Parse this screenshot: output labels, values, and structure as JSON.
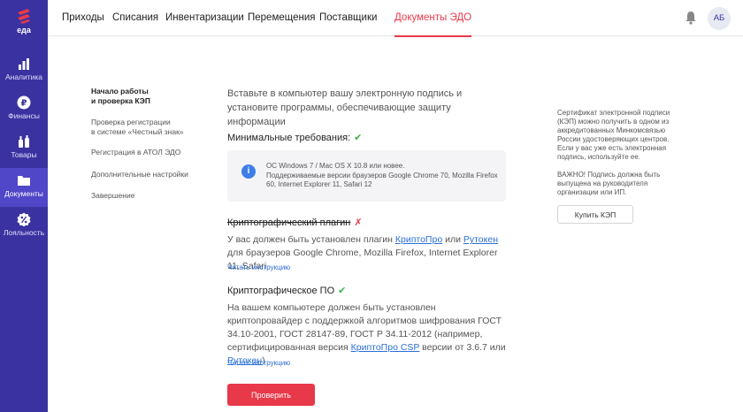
{
  "brand": {
    "name": "еда"
  },
  "sidebar": {
    "items": [
      {
        "label": "Аналитика",
        "icon": "bar-chart-icon",
        "active": false
      },
      {
        "label": "Финансы",
        "icon": "ruble-icon",
        "active": false
      },
      {
        "label": "Товары",
        "icon": "bottles-icon",
        "active": false
      },
      {
        "label": "Документы",
        "icon": "folder-icon",
        "active": true
      },
      {
        "label": "Лояльность",
        "icon": "percent-badge-icon",
        "active": false
      }
    ]
  },
  "topnav": {
    "tabs": [
      {
        "label": "Приходы",
        "active": false
      },
      {
        "label": "Списания",
        "active": false
      },
      {
        "label": "Инвентаризации",
        "active": false
      },
      {
        "label": "Перемещения",
        "active": false
      },
      {
        "label": "Поставщики",
        "active": false
      },
      {
        "label": "Документы ЭДО",
        "active": true
      }
    ],
    "avatar_initials": "АБ"
  },
  "steps": [
    {
      "label": "Начало работы\nи проверка КЭП",
      "current": true
    },
    {
      "label": "Проверка регистрации\nв системе «Честный знак»",
      "current": false
    },
    {
      "label": "Регистрация в АТОЛ ЭДО",
      "current": false
    },
    {
      "label": "Дополнительные настройки",
      "current": false
    },
    {
      "label": "Завершение",
      "current": false
    }
  ],
  "main": {
    "intro": "Вставьте в компьютер вашу электронную подпись и установите программы, обеспечивающие защиту информации",
    "min_req": {
      "title": "Минимальные требования:",
      "status": "✔",
      "info_line1": "ОС Windows 7 / Mac OS X 10.8 или новее.",
      "info_line2": "Поддерживаемые версии браузеров Google Chrome 70, Mozilla Firefox 60, Internet Explorer 11, Safari 12"
    },
    "plugin": {
      "title": "Криптографический плагин",
      "status": "✗",
      "text_before": "У вас должен быть установлен плагин ",
      "link1": "КриптоПро",
      "text_mid": " или ",
      "link2": "Рутокен",
      "text_after": " для браузеров Google Chrome, Mozilla Firefox, Internet Explorer 11, Safari",
      "instructions": "Читать инструкцию"
    },
    "software": {
      "title": "Криптографическое ПО",
      "status": "✔",
      "text_before": "На вашем компьютере должен быть установлен криптопровайдер с поддержкой алгоритмов шифрования ГОСТ 34.10-2001, ГОСТ 28147-89, ГОСТ Р 34.11-2012 (например, сертифицированная версия ",
      "link1": "КриптоПро CSP",
      "text_mid": " версии от 3.6.7 или ",
      "link2": "Рутокен",
      "text_after": ")",
      "instructions": "Читать инструкцию"
    },
    "check_button": "Проверить"
  },
  "aside": {
    "note1": "Сертификат электронной подписи (КЭП) можно получить в одном из аккредитованных Минкомсвязью России удостоверяющих центров. Если у вас уже есть электронная подпись, используйте ее.",
    "note2": "ВАЖНО! Подпись должна быть выпущена на руководителя организации или ИП.",
    "cert_button": "Купить КЭП"
  },
  "colors": {
    "sidebar": "#3a32a0",
    "sidebar_active": "#5046c8",
    "accent": "#e8394a",
    "link": "#2a6fd6",
    "ok": "#3ab34a",
    "info": "#3d7ee8"
  }
}
